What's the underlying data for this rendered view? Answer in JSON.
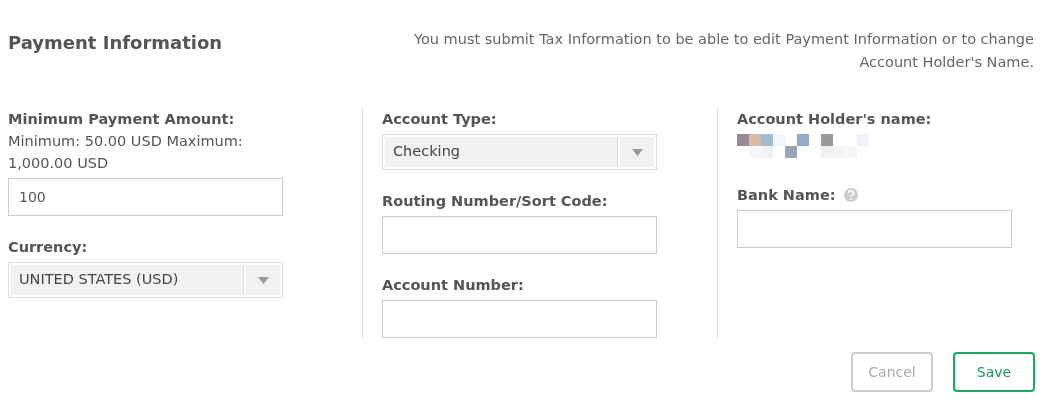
{
  "header": {
    "title": "Payment Information",
    "notice": "You must submit Tax Information to be able to edit Payment Information or to change Account Holder's Name."
  },
  "columns": [
    {
      "fields": [
        {
          "kind": "text",
          "label": "Minimum Payment Amount:",
          "note": "Minimum: 50.00 USD Maximum: 1,000.00 USD",
          "value": "100"
        },
        {
          "kind": "select",
          "label": "Currency:",
          "value": "UNITED STATES (USD)"
        }
      ]
    },
    {
      "fields": [
        {
          "kind": "select",
          "label": "Account Type:",
          "value": "Checking"
        },
        {
          "kind": "text",
          "label": "Routing Number/Sort Code:"
        },
        {
          "kind": "text",
          "label": "Account Number:"
        }
      ]
    },
    {
      "fields": [
        {
          "kind": "hidden",
          "label": "Account Holder's name:"
        },
        {
          "kind": "text",
          "label": "Bank Name:",
          "help": true
        }
      ]
    }
  ],
  "buttons": [
    {
      "label": "Cancel",
      "disabled": true
    },
    {
      "label": "Save",
      "disabled": false
    }
  ]
}
